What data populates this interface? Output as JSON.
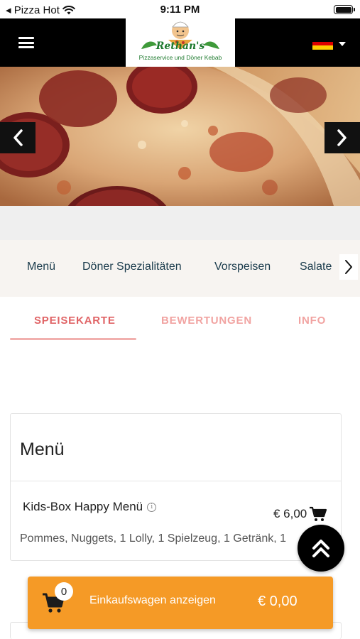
{
  "status_bar": {
    "carrier": "◂ Pizza Hot",
    "time": "9:11 PM"
  },
  "header": {
    "logo_caption": "Pizzaservice und Döner Kebab",
    "logo_name": "Rethan's",
    "language": "de",
    "flag_colors": [
      "#000000",
      "#dd0000",
      "#ffce00"
    ]
  },
  "categories": [
    "Menü",
    "Döner Spezialitäten",
    "Vorspeisen",
    "Salate"
  ],
  "tabs": [
    "SPEISEKARTE",
    "BEWERTUNGEN",
    "INFO"
  ],
  "menu": {
    "title": "Menü",
    "item": {
      "name": "Kids-Box Happy Menü",
      "price": "€ 6,00",
      "description": "Pommes, Nuggets, 1 Lolly, 1 Spielzeug, 1 Getränk, 1"
    }
  },
  "cart": {
    "count": "0",
    "label": "Einkaufswagen anzeigen",
    "total": "€ 0,00"
  },
  "colors": {
    "accent_tab": "#e06466",
    "cart_bar": "#f59a26",
    "category_text": "#1a3b4c"
  }
}
